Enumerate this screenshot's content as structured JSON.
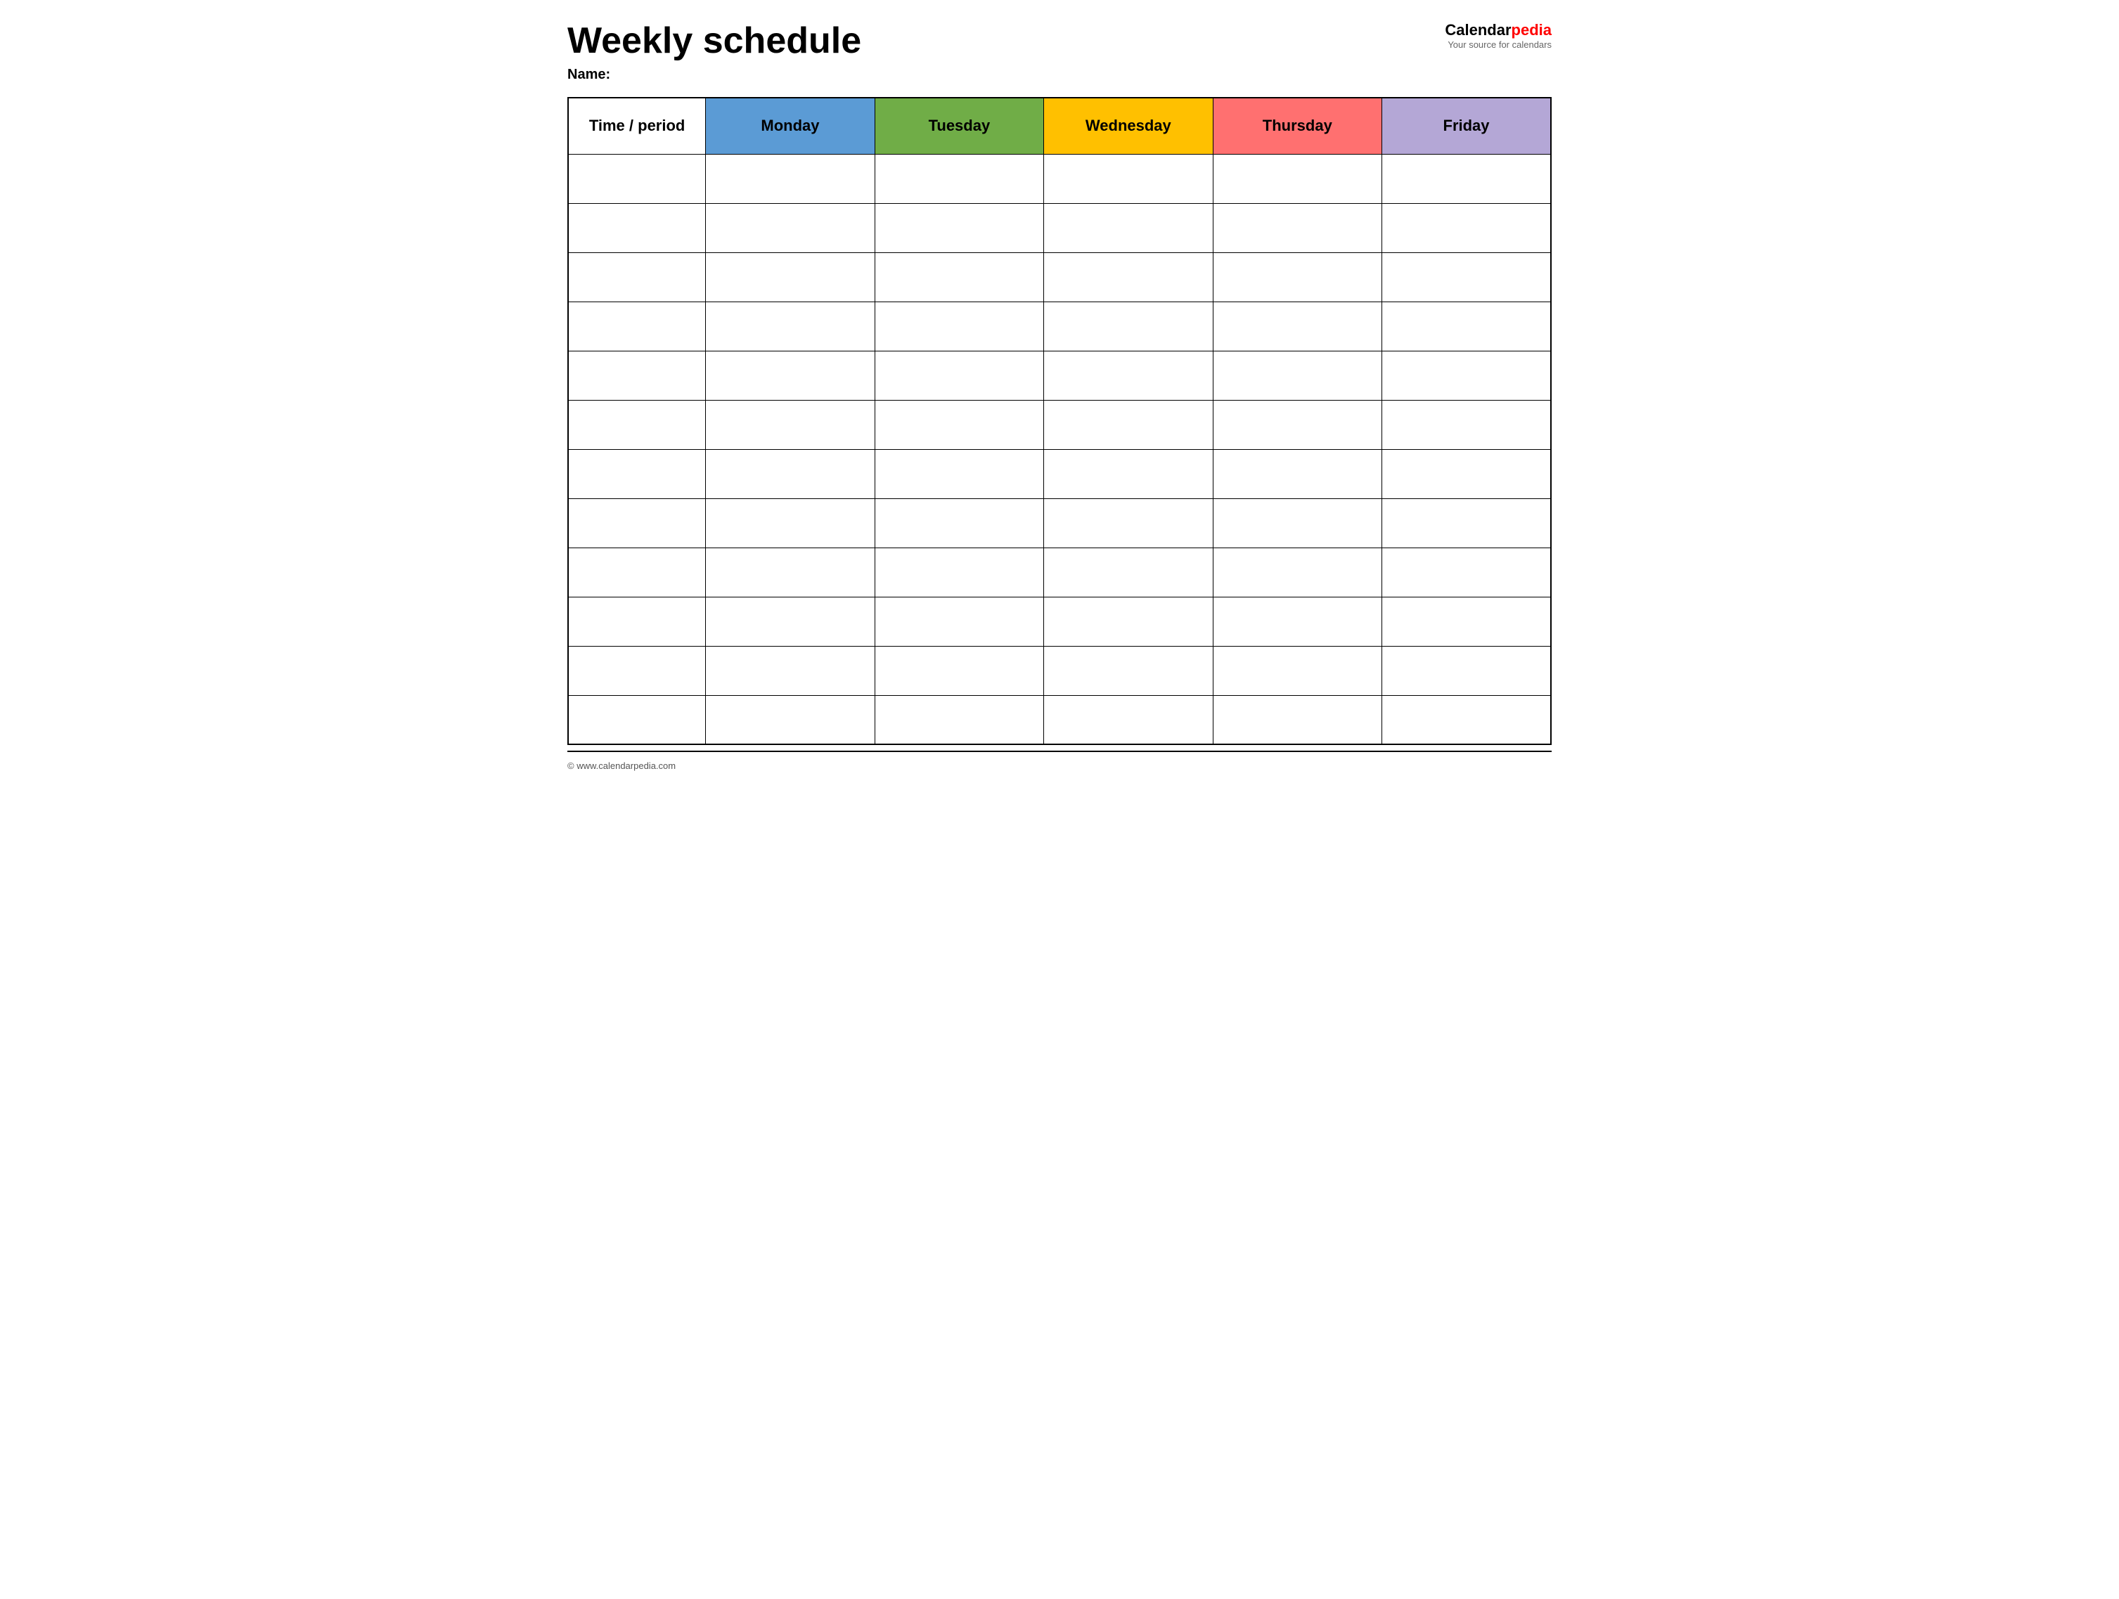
{
  "header": {
    "title": "Weekly schedule",
    "name_label": "Name:",
    "logo": {
      "calendar_part": "Calendar",
      "pedia_part": "pedia",
      "tagline": "Your source for calendars"
    }
  },
  "table": {
    "columns": [
      {
        "id": "time",
        "label": "Time / period",
        "color": "#ffffff",
        "text_color": "#000000"
      },
      {
        "id": "monday",
        "label": "Monday",
        "color": "#5b9bd5",
        "text_color": "#000000"
      },
      {
        "id": "tuesday",
        "label": "Tuesday",
        "color": "#70ad47",
        "text_color": "#000000"
      },
      {
        "id": "wednesday",
        "label": "Wednesday",
        "color": "#ffc000",
        "text_color": "#000000"
      },
      {
        "id": "thursday",
        "label": "Thursday",
        "color": "#ff7070",
        "text_color": "#000000"
      },
      {
        "id": "friday",
        "label": "Friday",
        "color": "#b4a7d6",
        "text_color": "#000000"
      }
    ],
    "row_count": 12
  },
  "footer": {
    "copyright": "© www.calendarpedia.com"
  }
}
